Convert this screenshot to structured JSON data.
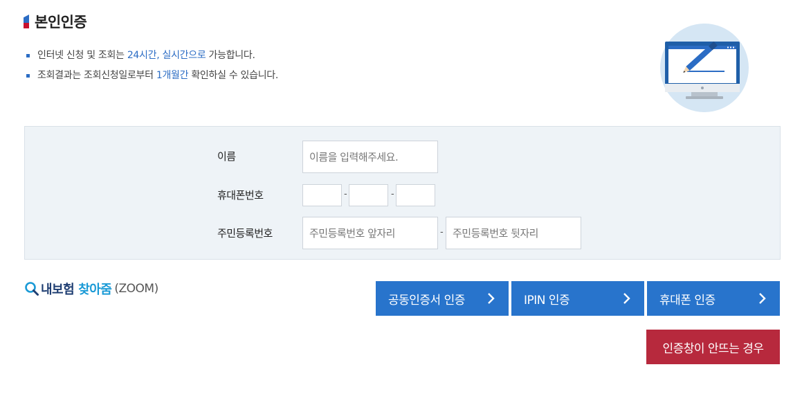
{
  "header": {
    "title": "본인인증"
  },
  "notices": [
    {
      "pre": "인터넷 신청 및 조회는 ",
      "highlight": "24시간, 실시간으로",
      "post": " 가능합니다."
    },
    {
      "pre": "조회결과는 조회신청일로부터 ",
      "highlight": "1개월간",
      "post": " 확인하실 수 있습니다."
    }
  ],
  "form": {
    "name_label": "이름",
    "name_placeholder": "이름을 입력해주세요.",
    "phone_label": "휴대폰번호",
    "phone_sep": "-",
    "rrn_label": "주민등록번호",
    "rrn_front_placeholder": "주민등록번호 앞자리",
    "rrn_back_placeholder": "주민등록번호 뒷자리",
    "rrn_sep": "-"
  },
  "zoom": {
    "part1": "내보험",
    "part2": "찾아줌",
    "part3": "(ZOOM)"
  },
  "buttons": {
    "cert": "공동인증서 인증",
    "ipin": "IPIN 인증",
    "phone": "휴대폰 인증",
    "popup_help": "인증창이 안뜨는 경우"
  },
  "colors": {
    "accent": "#2874cc",
    "danger": "#b7293d",
    "highlight": "#2b6cc4",
    "form_bg": "#eef3f7"
  },
  "icons": [
    "search-icon",
    "monitor-pen-icon",
    "chevron-right-icon"
  ]
}
